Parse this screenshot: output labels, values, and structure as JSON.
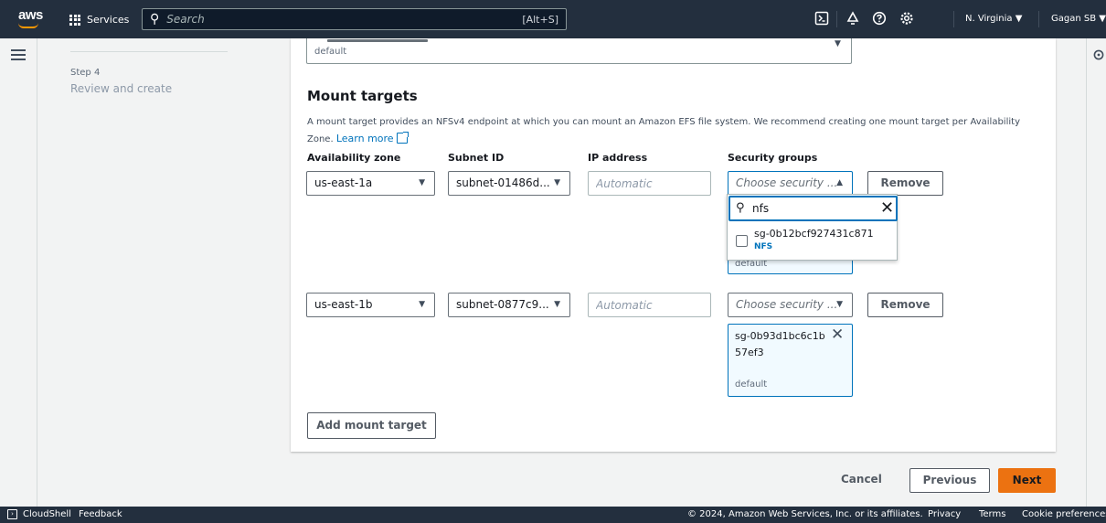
{
  "topnav": {
    "logo": "aws",
    "services_label": "Services",
    "search_placeholder": "Search",
    "search_shortcut": "[Alt+S]",
    "region": "N. Virginia ▼",
    "user": "Gagan SB ▼"
  },
  "sidebar": {
    "step_label": "Step 4",
    "step_title": "Review and create"
  },
  "vpc": {
    "security_default": "default"
  },
  "mount_targets": {
    "title": "Mount targets",
    "description": "A mount target provides an NFSv4 endpoint at which you can mount an Amazon EFS file system. We recommend creating one mount target per Availability Zone.",
    "learn_more": "Learn more",
    "columns": [
      "Availability zone",
      "Subnet ID",
      "IP address",
      "Security groups"
    ],
    "rows": [
      {
        "az": "us-east-1a",
        "subnet": "subnet-01486d...",
        "ip_placeholder": "Automatic",
        "sg_placeholder": "Choose security ...",
        "sg_caret": "▲",
        "remove": "Remove",
        "token_desc": "default"
      },
      {
        "az": "us-east-1b",
        "subnet": "subnet-0877c9...",
        "ip_placeholder": "Automatic",
        "sg_placeholder": "Choose security ...",
        "sg_caret": "▼",
        "remove": "Remove",
        "token_id": "sg-0b93d1bc6c1b57ef3",
        "token_desc": "default"
      }
    ],
    "dropdown": {
      "filter_value": "nfs",
      "option_id": "sg-0b12bcf927431c871",
      "option_name": "NFS"
    },
    "add_button": "Add mount target"
  },
  "footer": {
    "cancel": "Cancel",
    "previous": "Previous",
    "next": "Next"
  },
  "bottombar": {
    "cloudshell": "CloudShell",
    "feedback": "Feedback",
    "copyright": "© 2024, Amazon Web Services, Inc. or its affiliates.",
    "privacy": "Privacy",
    "terms": "Terms",
    "cookies": "Cookie preferences"
  },
  "colors": {
    "nav_bg": "#232f3e",
    "accent_orange": "#ec7211",
    "link_blue": "#0073bb"
  }
}
